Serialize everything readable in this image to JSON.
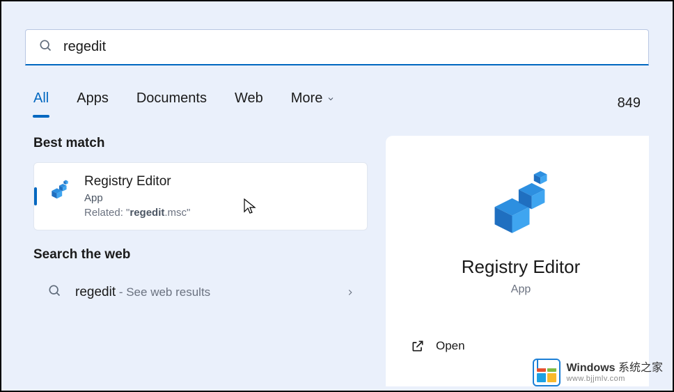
{
  "search": {
    "value": "regedit"
  },
  "tabs": {
    "items": [
      "All",
      "Apps",
      "Documents",
      "Web",
      "More"
    ],
    "active": "All",
    "right_number": "849"
  },
  "best_match": {
    "heading": "Best match",
    "title": "Registry Editor",
    "subtitle": "App",
    "related_prefix": "Related: \"",
    "related_bold": "regedit",
    "related_rest": ".msc\"",
    "icon": "registry-cubes-icon"
  },
  "web": {
    "heading": "Search the web",
    "query": "regedit",
    "hint": " - See web results"
  },
  "panel": {
    "title": "Registry Editor",
    "subtitle": "App",
    "open_label": "Open"
  },
  "watermark": {
    "line1_bold": "Windows",
    "line1_rest": " 系统之家",
    "line2": "www.bjjmlv.com"
  }
}
